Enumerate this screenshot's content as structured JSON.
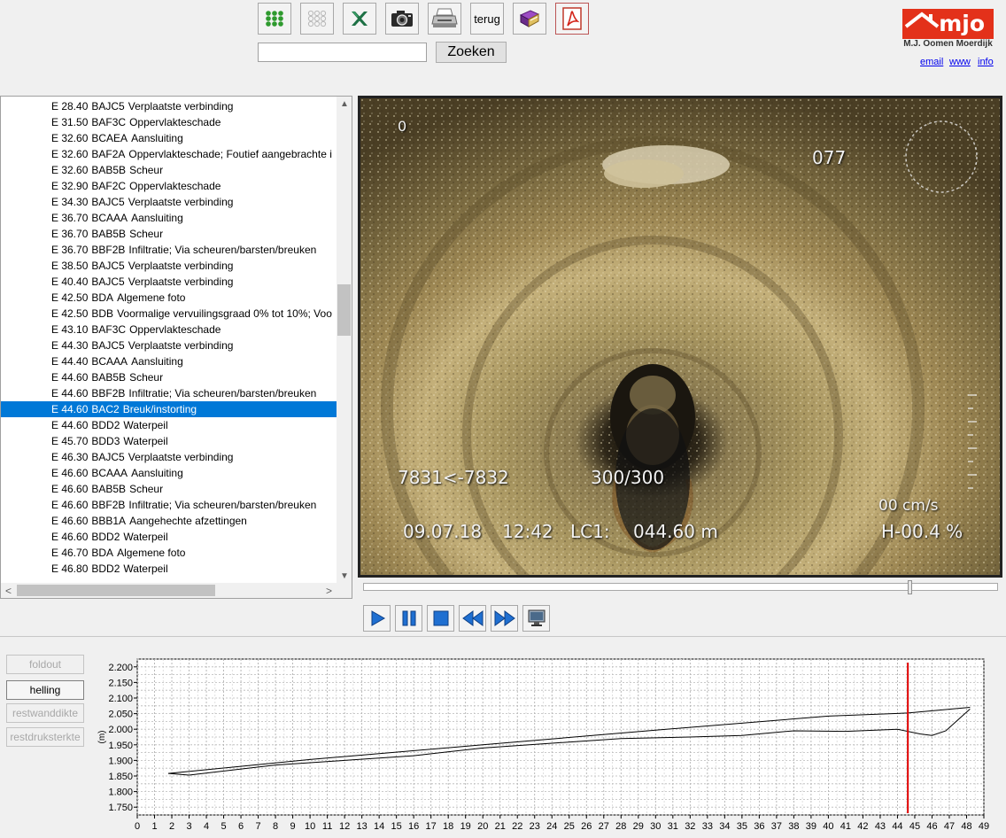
{
  "toolbar": {
    "buttons": [
      {
        "name": "green-dots-icon",
        "icon": "dot-grid-green"
      },
      {
        "name": "grey-dots-icon",
        "icon": "dot-grid-grey"
      },
      {
        "name": "excel-icon",
        "icon": "excel-x"
      },
      {
        "name": "camera-icon",
        "icon": "camera"
      },
      {
        "name": "printer-icon",
        "icon": "printer"
      },
      {
        "name": "back-button",
        "label": "terug"
      },
      {
        "name": "book-icon",
        "icon": "book"
      },
      {
        "name": "pdf-icon",
        "icon": "pdf"
      }
    ],
    "search_value": "",
    "search_button": "Zoeken"
  },
  "logo": {
    "text": "mjo",
    "subtitle": "M.J. Oomen Moerdijk",
    "color": "#e3311a"
  },
  "links": [
    "email",
    "www",
    "info"
  ],
  "observations": [
    {
      "pos": "E 28.40",
      "code": "BAJC5",
      "text": "Verplaatste verbinding"
    },
    {
      "pos": "E 31.50",
      "code": "BAF3C",
      "text": "Oppervlakteschade"
    },
    {
      "pos": "E 32.60",
      "code": "BCAEA",
      "text": "Aansluiting"
    },
    {
      "pos": "E 32.60",
      "code": "BAF2A",
      "text": "Oppervlakteschade; Foutief aangebrachte i"
    },
    {
      "pos": "E 32.60",
      "code": "BAB5B",
      "text": "Scheur"
    },
    {
      "pos": "E 32.90",
      "code": "BAF2C",
      "text": "Oppervlakteschade"
    },
    {
      "pos": "E 34.30",
      "code": "BAJC5",
      "text": "Verplaatste verbinding"
    },
    {
      "pos": "E 36.70",
      "code": "BCAAA",
      "text": "Aansluiting"
    },
    {
      "pos": "E 36.70",
      "code": "BAB5B",
      "text": "Scheur"
    },
    {
      "pos": "E 36.70",
      "code": "BBF2B",
      "text": "Infiltratie; Via scheuren/barsten/breuken"
    },
    {
      "pos": "E 38.50",
      "code": "BAJC5",
      "text": "Verplaatste verbinding"
    },
    {
      "pos": "E 40.40",
      "code": "BAJC5",
      "text": "Verplaatste verbinding"
    },
    {
      "pos": "E 42.50",
      "code": "BDA",
      "text": "Algemene foto"
    },
    {
      "pos": "E 42.50",
      "code": "BDB",
      "text": "Voormalige vervuilingsgraad 0% tot 10%; Voo"
    },
    {
      "pos": "E 43.10",
      "code": "BAF3C",
      "text": "Oppervlakteschade"
    },
    {
      "pos": "E 44.30",
      "code": "BAJC5",
      "text": "Verplaatste verbinding"
    },
    {
      "pos": "E 44.40",
      "code": "BCAAA",
      "text": "Aansluiting"
    },
    {
      "pos": "E 44.60",
      "code": "BAB5B",
      "text": "Scheur"
    },
    {
      "pos": "E 44.60",
      "code": "BBF2B",
      "text": "Infiltratie; Via scheuren/barsten/breuken"
    },
    {
      "pos": "E 44.60",
      "code": "BAC2",
      "text": "Breuk/instorting",
      "selected": true
    },
    {
      "pos": "E 44.60",
      "code": "BDD2",
      "text": "Waterpeil"
    },
    {
      "pos": "E 45.70",
      "code": "BDD3",
      "text": "Waterpeil"
    },
    {
      "pos": "E 46.30",
      "code": "BAJC5",
      "text": "Verplaatste verbinding"
    },
    {
      "pos": "E 46.60",
      "code": "BCAAA",
      "text": "Aansluiting"
    },
    {
      "pos": "E 46.60",
      "code": "BAB5B",
      "text": "Scheur"
    },
    {
      "pos": "E 46.60",
      "code": "BBF2B",
      "text": "Infiltratie; Via scheuren/barsten/breuken"
    },
    {
      "pos": "E 46.60",
      "code": "BBB1A",
      "text": "Aangehechte afzettingen"
    },
    {
      "pos": "E 46.60",
      "code": "BDD2",
      "text": "Waterpeil"
    },
    {
      "pos": "E 46.70",
      "code": "BDA",
      "text": "Algemene foto"
    },
    {
      "pos": "E 46.80",
      "code": "BDD2",
      "text": "Waterpeil"
    }
  ],
  "video_osd": {
    "top_left": "0",
    "top_right": "077",
    "pipe_ids": "7831<-7832",
    "frame": "300/300",
    "speed": "00 cm/s",
    "date": "09.07.18",
    "time": "12:42",
    "lc_label": "LC1:",
    "distance": "044.60 m",
    "incline": "H-00.4 %"
  },
  "player": {
    "seek_fraction": 0.86,
    "buttons": [
      "play-button",
      "pause-button",
      "stop-button",
      "rewind-button",
      "fast-forward-button",
      "monitor-button"
    ]
  },
  "side_buttons": [
    {
      "name": "foldout-button",
      "label": "foldout",
      "active": false
    },
    {
      "name": "helling-button",
      "label": "helling",
      "active": true
    },
    {
      "name": "restwanddikte-button",
      "label": "restwanddikte",
      "active": false
    },
    {
      "name": "restdruksterkte-button",
      "label": "restdruksterkte",
      "active": false
    }
  ],
  "chart_data": {
    "type": "line",
    "ylabel": "(m)",
    "xlim": [
      0,
      49
    ],
    "ylim": [
      1.725,
      2.225
    ],
    "x_ticks": [
      0,
      1,
      2,
      3,
      4,
      5,
      6,
      7,
      8,
      9,
      10,
      11,
      12,
      13,
      14,
      15,
      16,
      17,
      18,
      19,
      20,
      21,
      22,
      23,
      24,
      25,
      26,
      27,
      28,
      29,
      30,
      31,
      32,
      33,
      34,
      35,
      36,
      37,
      38,
      39,
      40,
      41,
      42,
      43,
      44,
      45,
      46,
      47,
      48,
      49
    ],
    "y_ticks": [
      "1.750",
      "1.800",
      "1.850",
      "1.900",
      "1.950",
      "2.000",
      "2.050",
      "2.100",
      "2.150",
      "2.200"
    ],
    "y_tick_values": [
      1.75,
      1.8,
      1.85,
      1.9,
      1.95,
      2.0,
      2.05,
      2.1,
      2.15,
      2.2
    ],
    "grid": true,
    "series": [
      {
        "color": "#000000",
        "x": [
          1.8,
          10,
          20,
          30,
          40,
          44.6,
          48.2
        ],
        "y": [
          1.858,
          1.903,
          1.95,
          1.997,
          2.042,
          2.052,
          2.07
        ]
      },
      {
        "color": "#000000",
        "x": [
          1.8,
          3,
          8,
          12,
          16,
          20,
          24,
          28,
          32,
          35,
          38,
          41,
          44,
          45.3,
          46,
          46.8,
          47.5,
          48.2
        ],
        "y": [
          1.858,
          1.853,
          1.885,
          1.9,
          1.915,
          1.94,
          1.955,
          1.97,
          1.975,
          1.98,
          1.995,
          1.993,
          2.0,
          1.985,
          1.98,
          1.995,
          2.03,
          2.065
        ]
      }
    ],
    "marker": {
      "x": 44.6,
      "color": "#e00000"
    }
  }
}
